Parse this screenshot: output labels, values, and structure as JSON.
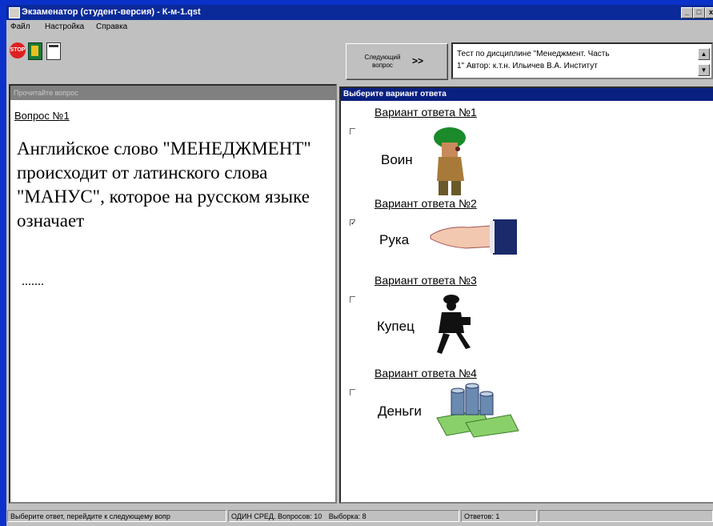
{
  "window": {
    "title": "Экзаменатор (студент-версия) - К-м-1.qst"
  },
  "menu": {
    "items": [
      "Файл",
      "Настройка",
      "Справка"
    ]
  },
  "toolbar": {
    "stop_icon_text": "STOP",
    "next_button_label": "Следующий вопрос",
    "next_button_arrows": ">>"
  },
  "info": {
    "line1": "Тест по дисциплине \"Менеджмент. Часть",
    "line2": "1\" Автор: к.т.н. Ильичев В.А. Институт"
  },
  "question_panel": {
    "header": "Прочитайте вопрос",
    "title": "Вопрос №1",
    "text": "Английское слово \"МЕНЕДЖМЕНТ\" происходит от латинского слова \"МАНУС\", которое на русском языке означает",
    "dots": "......."
  },
  "answer_panel": {
    "header": "Выберите вариант ответа",
    "options": [
      {
        "title": "Вариант ответа №1",
        "label": "Воин",
        "checked": false,
        "image": "warrior-icon"
      },
      {
        "title": "Вариант ответа №2",
        "label": "Рука",
        "checked": true,
        "image": "hand-icon"
      },
      {
        "title": "Вариант ответа №3",
        "label": "Купец",
        "checked": false,
        "image": "merchant-icon"
      },
      {
        "title": "Вариант ответа №4",
        "label": "Деньги",
        "checked": false,
        "image": "money-icon"
      }
    ]
  },
  "status": {
    "hint": "Выберите ответ, перейдите к следующему вопр",
    "mode": "ОДИН СРЕД.",
    "questions": "Вопросов: 10",
    "sample": "Выборка: 8",
    "answers": "Ответов: 1"
  },
  "colors": {
    "desktop": "#0a31c9",
    "titlebar": "#0a2a9a",
    "answer_header": "#0a2080",
    "face": "#c0c0c0"
  }
}
